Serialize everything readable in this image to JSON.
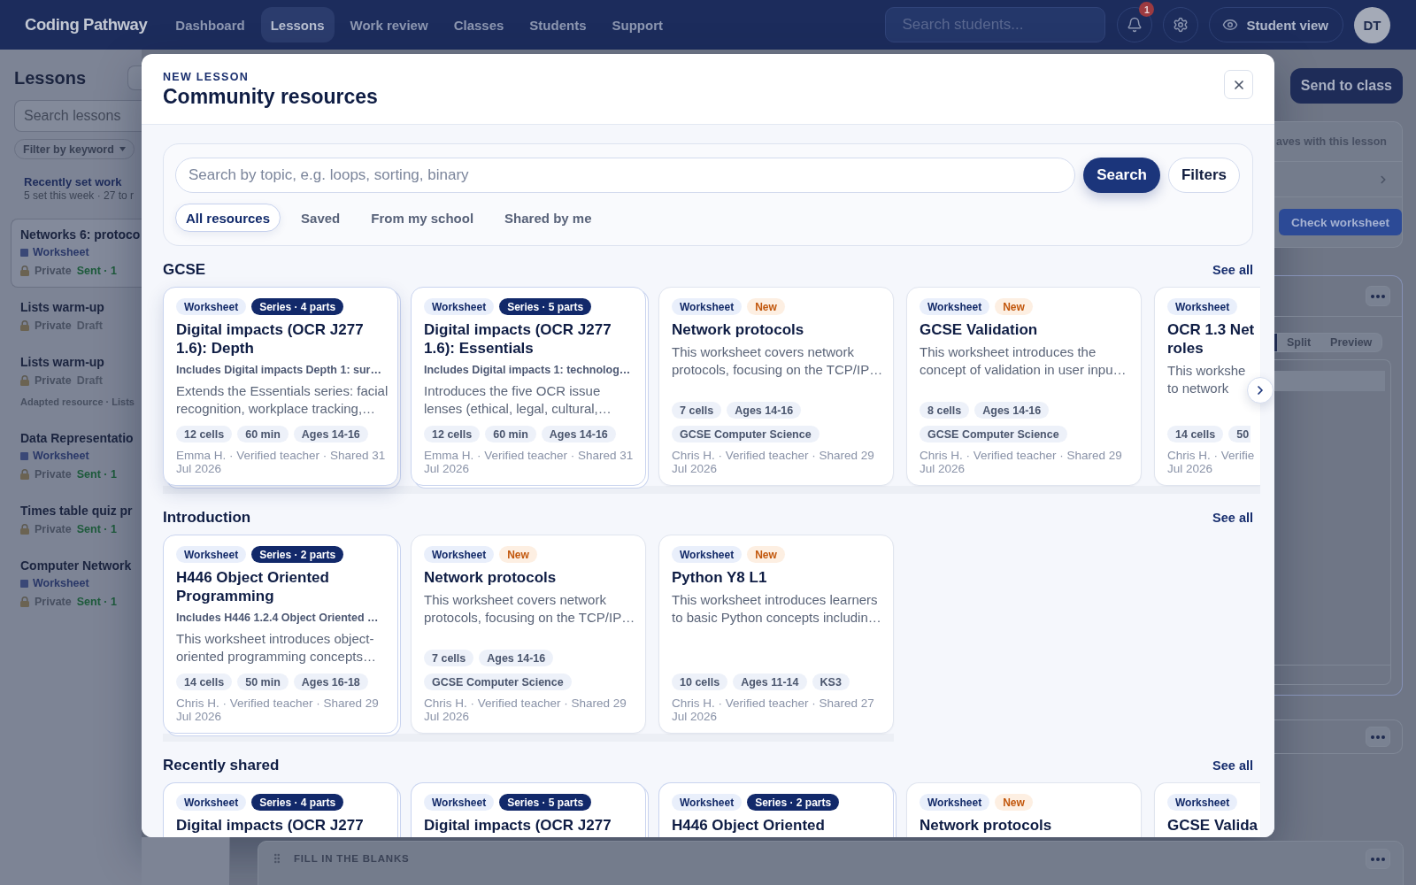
{
  "nav": {
    "logo": "Coding Pathway",
    "items": [
      {
        "label": "Dashboard",
        "selected": false
      },
      {
        "label": "Lessons",
        "selected": true
      },
      {
        "label": "Work review",
        "selected": false
      },
      {
        "label": "Classes",
        "selected": false
      },
      {
        "label": "Students",
        "selected": false
      },
      {
        "label": "Support",
        "selected": false
      }
    ],
    "search": {
      "placeholder": "Search students..."
    },
    "notification_count": "1",
    "student_view": "Student view",
    "avatar": "DT"
  },
  "sidebar": {
    "title": "Lessons",
    "search": {
      "placeholder": "Search lessons"
    },
    "filter": "Filter by keyword",
    "recent": {
      "title": "Recently set work",
      "summary": "5 set this week · 27 to r"
    },
    "lessons": [
      {
        "title": "Networks 6: protoco",
        "type": "Worksheet",
        "privacy": "Private",
        "status": {
          "label": "Sent · 1",
          "kind": "sent"
        },
        "selected": true
      },
      {
        "title": "Lists warm-up",
        "privacy": "Private",
        "status": {
          "label": "Draft",
          "kind": "draft"
        },
        "selected": false
      },
      {
        "title": "Lists warm-up",
        "privacy": "Private",
        "status": {
          "label": "Draft",
          "kind": "draft"
        },
        "note": "Adapted resource · Lists",
        "selected": false
      },
      {
        "title": "Data Representatio",
        "type": "Worksheet",
        "privacy": "Private",
        "status": {
          "label": "Sent · 1",
          "kind": "sent"
        },
        "selected": false
      },
      {
        "title": "Times table quiz pr",
        "privacy": "Private",
        "status": {
          "label": "Sent · 1",
          "kind": "sent"
        },
        "selected": false
      },
      {
        "title": "Computer Network",
        "type": "Worksheet",
        "privacy": "Private",
        "status": {
          "label": "Sent · 1",
          "kind": "sent"
        },
        "selected": false
      }
    ]
  },
  "modal": {
    "eyebrow": "NEW LESSON",
    "title": "Community resources",
    "search": {
      "placeholder": "Search by topic, e.g. loops, sorting, binary"
    },
    "search_button": "Search",
    "filters_button": "Filters",
    "tabs": [
      {
        "label": "All resources",
        "selected": true
      },
      {
        "label": "Saved",
        "selected": false
      },
      {
        "label": "From my school",
        "selected": false
      },
      {
        "label": "Shared by me",
        "selected": false
      }
    ],
    "sections": [
      {
        "title": "GCSE",
        "see_all": "See all",
        "more_button": true,
        "cards": [
          {
            "kind": "full",
            "tags": [
              {
                "label": "Worksheet",
                "kind": "type"
              },
              {
                "label": "Series · 4 parts",
                "kind": "series"
              }
            ],
            "title": "Digital impacts (OCR J277\n1.6): Depth",
            "includes": "Includes Digital impacts Depth 1: sur…",
            "description": "Extends the Essentials series: facial\nrecognition, workplace tracking,…",
            "details": [
              "12 cells",
              "60 min",
              "Ages 14-16"
            ],
            "meta": "Emma H. · Verified teacher · Shared 31\nJul 2026",
            "stacked": true,
            "highlighted": true
          },
          {
            "kind": "full",
            "tags": [
              {
                "label": "Worksheet",
                "kind": "type"
              },
              {
                "label": "Series · 5 parts",
                "kind": "series"
              }
            ],
            "title": "Digital impacts (OCR J277\n1.6): Essentials",
            "includes": "Includes Digital impacts 1: technolog…",
            "description": "Introduces the five OCR issue\nlenses (ethical, legal, cultural,…",
            "details": [
              "12 cells",
              "60 min",
              "Ages 14-16"
            ],
            "meta": "Emma H. · Verified teacher · Shared 31\nJul 2026",
            "stacked": true,
            "highlighted": false
          },
          {
            "kind": "full",
            "tags": [
              {
                "label": "Worksheet",
                "kind": "type"
              },
              {
                "label": "New",
                "kind": "new"
              }
            ],
            "title": "Network protocols",
            "description": "This worksheet covers network\nprotocols, focusing on the TCP/IP…",
            "details": [
              "7 cells",
              "Ages 14-16",
              "GCSE Computer Science"
            ],
            "meta": "Chris H. · Verified teacher · Shared 29\nJul 2026",
            "stacked": false,
            "highlighted": false
          },
          {
            "kind": "full",
            "tags": [
              {
                "label": "Worksheet",
                "kind": "type"
              },
              {
                "label": "New",
                "kind": "new"
              }
            ],
            "title": "GCSE Validation",
            "description": "This worksheet introduces the\nconcept of validation in user inpu…",
            "details": [
              "8 cells",
              "Ages 14-16",
              "GCSE Computer Science"
            ],
            "meta": "Chris H. · Verified teacher · Shared 29\nJul 2026",
            "stacked": false,
            "highlighted": false
          },
          {
            "kind": "clipped",
            "tags": [
              {
                "label": "Worksheet",
                "kind": "type"
              }
            ],
            "title": "OCR 1.3 Net\nroles",
            "description": "This workshe\nto network",
            "details": [
              "14 cells",
              "50"
            ],
            "meta": "Chris H. · Verifie\nJul 2026",
            "stacked": false,
            "highlighted": false
          }
        ]
      },
      {
        "title": "Introduction",
        "see_all": "See all",
        "more_button": false,
        "cards": [
          {
            "kind": "full",
            "tags": [
              {
                "label": "Worksheet",
                "kind": "type"
              },
              {
                "label": "Series · 2 parts",
                "kind": "series"
              }
            ],
            "title": "H446 Object Oriented\nProgramming",
            "includes": "Includes H446 1.2.4 Object Oriented …",
            "description": "This worksheet introduces object-\noriented programming concepts…",
            "details": [
              "14 cells",
              "50 min",
              "Ages 16-18"
            ],
            "meta": "Chris H. · Verified teacher · Shared 29\nJul 2026",
            "stacked": true,
            "highlighted": false
          },
          {
            "kind": "full",
            "tags": [
              {
                "label": "Worksheet",
                "kind": "type"
              },
              {
                "label": "New",
                "kind": "new"
              }
            ],
            "title": "Network protocols",
            "description": "This worksheet covers network\nprotocols, focusing on the TCP/IP…",
            "details": [
              "7 cells",
              "Ages 14-16",
              "GCSE Computer Science"
            ],
            "meta": "Chris H. · Verified teacher · Shared 29\nJul 2026",
            "stacked": false,
            "highlighted": false
          },
          {
            "kind": "full",
            "tags": [
              {
                "label": "Worksheet",
                "kind": "type"
              },
              {
                "label": "New",
                "kind": "new"
              }
            ],
            "title": "Python Y8 L1",
            "description": "This worksheet introduces learners\nto basic Python concepts includin…",
            "details": [
              "10 cells",
              "Ages 11-14",
              "KS3"
            ],
            "meta": "Chris H. · Verified teacher · Shared 27\nJul 2026",
            "stacked": false,
            "highlighted": false
          }
        ]
      },
      {
        "title": "Recently shared",
        "see_all": "See all",
        "more_button": false,
        "cards": [
          {
            "kind": "peek",
            "tags": [
              {
                "label": "Worksheet",
                "kind": "type"
              },
              {
                "label": "Series · 4 parts",
                "kind": "series"
              }
            ],
            "title": "Digital impacts (OCR J277",
            "stacked": true,
            "highlighted": false
          },
          {
            "kind": "peek",
            "tags": [
              {
                "label": "Worksheet",
                "kind": "type"
              },
              {
                "label": "Series · 5 parts",
                "kind": "series"
              }
            ],
            "title": "Digital impacts (OCR J277",
            "stacked": true,
            "highlighted": false
          },
          {
            "kind": "peek",
            "tags": [
              {
                "label": "Worksheet",
                "kind": "type"
              },
              {
                "label": "Series · 2 parts",
                "kind": "series"
              }
            ],
            "title": "H446 Object Oriented",
            "stacked": true,
            "highlighted": false
          },
          {
            "kind": "peek",
            "tags": [
              {
                "label": "Worksheet",
                "kind": "type"
              },
              {
                "label": "New",
                "kind": "new"
              }
            ],
            "title": "Network protocols",
            "stacked": false,
            "highlighted": false
          },
          {
            "kind": "corner",
            "tags": [
              {
                "label": "Worksheet",
                "kind": "type"
              }
            ],
            "title": "GCSE Valida",
            "stacked": false,
            "highlighted": false
          }
        ]
      }
    ]
  },
  "side_panel": {
    "send_button": "Send to class",
    "banner": "aves with this lesson",
    "check_button": "Check worksheet",
    "view_modes": [
      {
        "label": "Split",
        "selected": false
      },
      {
        "label": "Preview",
        "selected": false
      }
    ]
  },
  "canvas_block": {
    "label": "FILL IN THE BLANKS"
  }
}
